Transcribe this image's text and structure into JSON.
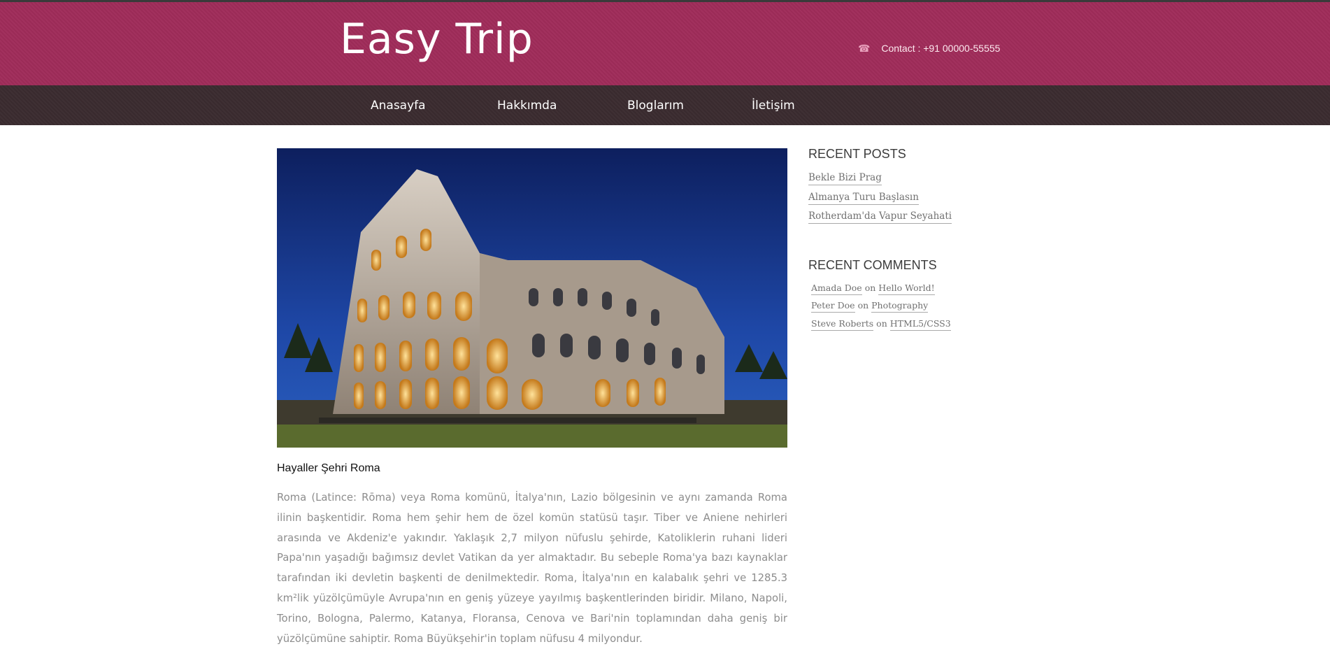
{
  "header": {
    "brand": "Easy Trip",
    "contact": "Contact : +91 00000-55555",
    "contact_icon": "phone-icon",
    "color": "#a02c5a"
  },
  "nav": {
    "items": [
      {
        "label": "Anasayfa"
      },
      {
        "label": "Hakkımda"
      },
      {
        "label": "Bloglarım"
      },
      {
        "label": "İletişim"
      }
    ],
    "color": "#3b2c30"
  },
  "post": {
    "image_subject": "colosseum-photo",
    "title": "Hayaller Şehri Roma",
    "body": "Roma (Latince: Rōma) veya Roma komünü, İtalya'nın, Lazio bölgesinin ve aynı zamanda Roma ilinin başkentidir. Roma hem şehir hem de özel komün statüsü taşır. Tiber ve Aniene nehirleri arasında ve Akdeniz'e yakındır. Yaklaşık 2,7 milyon nüfuslu şehirde, Katoliklerin ruhani lideri Papa'nın yaşadığı bağımsız devlet Vatikan da yer almaktadır. Bu sebeple Roma'ya bazı kaynaklar tarafından iki devletin başkenti de denilmektedir. Roma, İtalya'nın en kalabalık şehri ve 1285.3 km²lik yüzölçümüyle Avrupa'nın en geniş yüzeye yayılmış başkentlerinden biridir. Milano, Napoli, Torino, Bologna, Palermo, Katanya, Floransa, Cenova ve Bari'nin toplamından daha geniş bir yüzölçümüne sahiptir. Roma Büyükşehir'in toplam nüfusu 4 milyondur."
  },
  "sidebar": {
    "recent_posts_heading": "RECENT POSTS",
    "recent_posts": [
      {
        "label": "Bekle Bizi Prag"
      },
      {
        "label": "Almanya Turu Başlasın"
      },
      {
        "label": "Rotherdam'da Vapur Seyahati"
      }
    ],
    "recent_comments_heading": "RECENT COMMENTS",
    "comments": [
      {
        "author": "Amada Doe",
        "on": "on",
        "post": "Hello World!"
      },
      {
        "author": "Peter Doe",
        "on": "on",
        "post": "Photography"
      },
      {
        "author": "Steve Roberts",
        "on": "on",
        "post": "HTML5/CSS3"
      }
    ]
  }
}
